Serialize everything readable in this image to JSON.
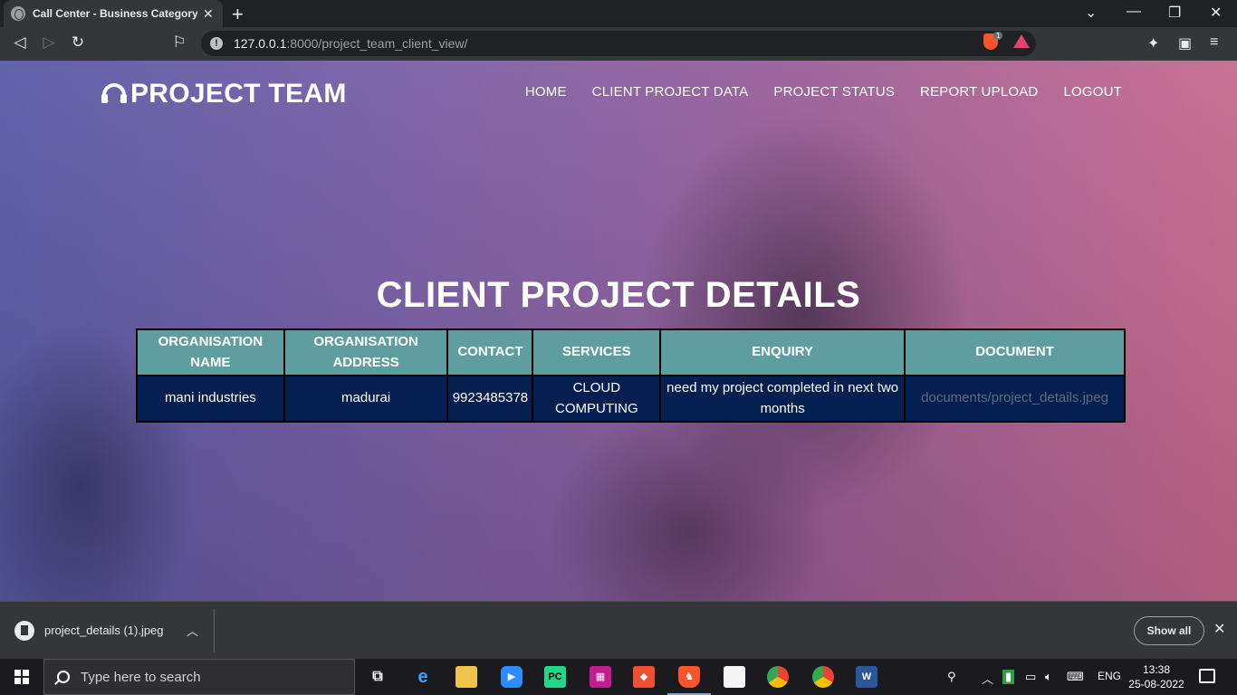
{
  "browser": {
    "tab_title": "Call Center - Business Category B",
    "tab_close": "✕",
    "new_tab": "+",
    "window_min": "—",
    "window_restore": "❐",
    "window_close": "✕",
    "dropdown": "⌄",
    "url_host": "127.0.0.1",
    "url_rest": ":8000/project_team_client_view/",
    "brave_count": "1",
    "icons": [
      "back-icon",
      "forward-icon",
      "reload-icon",
      "bookmark-icon",
      "info-icon",
      "brave-shield-icon",
      "brave-rewards-icon",
      "extensions-icon",
      "wallet-icon",
      "menu-icon"
    ]
  },
  "site": {
    "logo": "PROJECT TEAM",
    "nav": [
      "HOME",
      "CLIENT PROJECT DATA",
      "PROJECT STATUS",
      "REPORT UPLOAD",
      "LOGOUT"
    ],
    "heading": "CLIENT PROJECT DETAILS",
    "table": {
      "headers": [
        "ORGANISATION NAME",
        "ORGANISATION ADDRESS",
        "CONTACT",
        "SERVICES",
        "ENQUIRY",
        "DOCUMENT"
      ],
      "rows": [
        [
          "mani industries",
          "madurai",
          "9923485378",
          "CLOUD COMPUTING",
          "need my project completed in next two months",
          "documents/project_details.jpeg"
        ]
      ]
    }
  },
  "downloads": {
    "file_name": "project_details (1).jpeg",
    "show_all": "Show all"
  },
  "taskbar": {
    "search_placeholder": "Type here to search",
    "language": "ENG",
    "time": "13:38",
    "date": "25-08-2022"
  },
  "colors": {
    "table_header": "#5f9ea0",
    "table_cell": "#052050",
    "browser_bg": "#202124"
  }
}
